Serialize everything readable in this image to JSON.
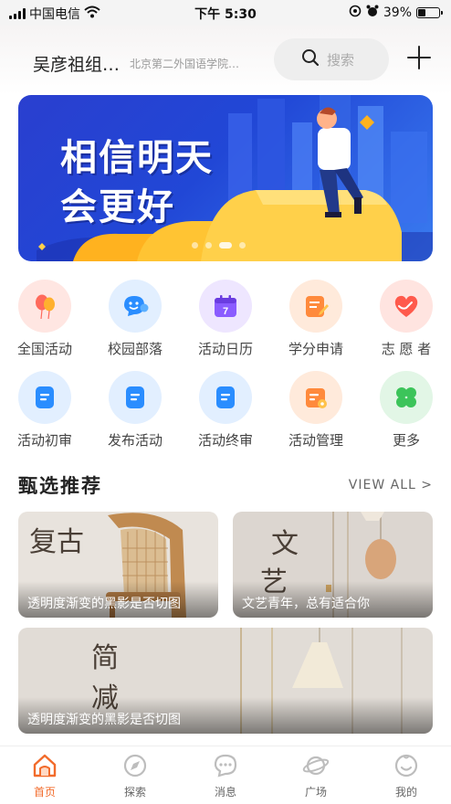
{
  "status_bar": {
    "carrier": "中国电信",
    "time": "下午 5:30",
    "battery_percent": "39%",
    "battery_level": 0.39,
    "icons": [
      "signal-icon",
      "wifi-icon",
      "location-icon",
      "alarm-icon",
      "battery-icon"
    ]
  },
  "header": {
    "org_name": "吴彦祖组织名称",
    "org_subtitle": "北京第二外国语学院学生会",
    "search_placeholder": "搜索",
    "icons": [
      "search-icon",
      "plus-icon"
    ]
  },
  "banner": {
    "line1": "相信明天",
    "line2": "会更好",
    "slides": 4,
    "active_slide": 2
  },
  "grid": {
    "items": [
      {
        "label": "全国活动",
        "icon": "balloon-icon",
        "color": "#ff6a5c",
        "bg": "#ffe6e2"
      },
      {
        "label": "校园部落",
        "icon": "chat-smile-icon",
        "color": "#2a8dff",
        "bg": "#e2efff"
      },
      {
        "label": "活动日历",
        "icon": "calendar-icon",
        "color": "#8a5cff",
        "bg": "#eee6ff"
      },
      {
        "label": "学分申请",
        "icon": "edit-note-icon",
        "color": "#ff8a3c",
        "bg": "#ffeadb"
      },
      {
        "label": "志 愿 者",
        "icon": "heart-hand-icon",
        "color": "#ff5a4c",
        "bg": "#ffe4e0"
      },
      {
        "label": "活动初审",
        "icon": "document-icon",
        "color": "#2a8dff",
        "bg": "#e2efff"
      },
      {
        "label": "发布活动",
        "icon": "document-icon",
        "color": "#2a8dff",
        "bg": "#e2efff"
      },
      {
        "label": "活动终审",
        "icon": "document-icon",
        "color": "#2a8dff",
        "bg": "#e2efff"
      },
      {
        "label": "活动管理",
        "icon": "manage-icon",
        "color": "#ff8a3c",
        "bg": "#ffeadb"
      },
      {
        "label": "更多",
        "icon": "clover-icon",
        "color": "#3cc45a",
        "bg": "#e2f6e6"
      }
    ]
  },
  "section": {
    "title": "甄选推荐",
    "view_all": "VIEW ALL >"
  },
  "cards": [
    {
      "big_text": "复古",
      "caption": "透明度渐变的黑影是否切图"
    },
    {
      "big_text_1": "文",
      "big_text_2": "艺",
      "caption": "文艺青年，总有适合你"
    },
    {
      "big_text_1": "简",
      "big_text_2": "减",
      "caption": "透明度渐变的黑影是否切图"
    }
  ],
  "tabbar": {
    "tabs": [
      {
        "label": "首页",
        "icon": "home-icon",
        "active": true
      },
      {
        "label": "探索",
        "icon": "compass-icon",
        "active": false
      },
      {
        "label": "消息",
        "icon": "message-icon",
        "active": false
      },
      {
        "label": "广场",
        "icon": "planet-icon",
        "active": false
      },
      {
        "label": "我的",
        "icon": "profile-icon",
        "active": false
      }
    ]
  },
  "colors": {
    "accent": "#f26b2b",
    "banner_blue": "#2147d6",
    "text": "#333333"
  }
}
